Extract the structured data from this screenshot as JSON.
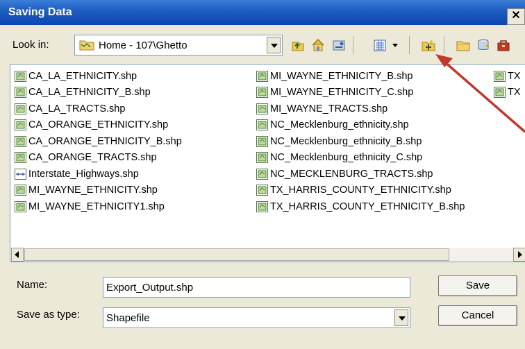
{
  "dialog": {
    "title": "Saving Data",
    "close_glyph": "✕"
  },
  "look_in": {
    "label": "Look in:",
    "value": "Home - 107\\Ghetto",
    "icon": "folder-icon"
  },
  "toolbar": {
    "buttons": [
      "up-one-level-icon",
      "home-icon",
      "connect-folder-icon",
      "view-list-icon",
      "view-dropdown-icon",
      "new-folder-icon",
      "folder-icon",
      "database-icon",
      "toolbox-icon"
    ]
  },
  "files": {
    "col1": [
      "CA_LA_ETHNICITY.shp",
      "CA_LA_ETHNICITY_B.shp",
      "CA_LA_TRACTS.shp",
      "CA_ORANGE_ETHNICITY.shp",
      "CA_ORANGE_ETHNICITY_B.shp",
      "CA_ORANGE_TRACTS.shp",
      "Interstate_Highways.shp",
      "MI_WAYNE_ETHNICITY.shp",
      "MI_WAYNE_ETHNICITY1.shp"
    ],
    "col2": [
      "MI_WAYNE_ETHNICITY_B.shp",
      "MI_WAYNE_ETHNICITY_C.shp",
      "MI_WAYNE_TRACTS.shp",
      "NC_Mecklenburg_ethnicity.shp",
      "NC_Mecklenburg_ethnicity_B.shp",
      "NC_Mecklenburg_ethnicity_C.shp",
      "NC_MECKLENBURG_TRACTS.shp",
      "TX_HARRIS_COUNTY_ETHNICITY.shp",
      "TX_HARRIS_COUNTY_ETHNICITY_B.shp"
    ],
    "col3": [
      "TX",
      "TX"
    ],
    "line_icon_item": "Interstate_Highways.shp"
  },
  "name": {
    "label": "Name:",
    "value": "Export_Output.shp"
  },
  "save_as_type": {
    "label": "Save as type:",
    "value": "Shapefile"
  },
  "buttons": {
    "save": "Save",
    "cancel": "Cancel"
  },
  "colors": {
    "title_bar": "#0a46b0",
    "arrow": "#c0392b"
  }
}
